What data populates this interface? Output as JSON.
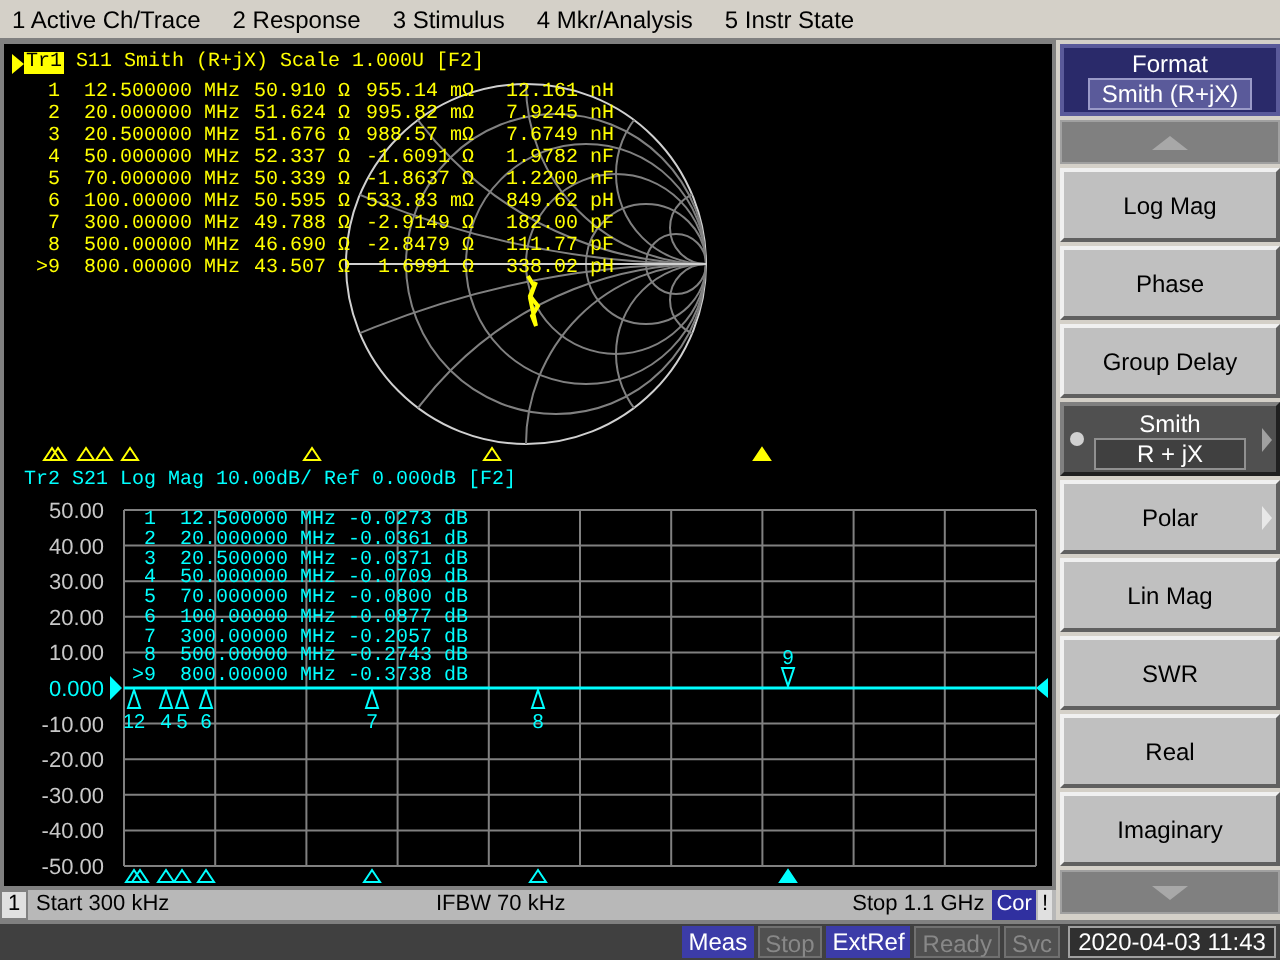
{
  "menu_bar": [
    "1 Active Ch/Trace",
    "2 Response",
    "3 Stimulus",
    "4 Mkr/Analysis",
    "5 Instr State"
  ],
  "trace1": {
    "label": "Tr1",
    "active": true,
    "header": "S11 Smith (R+jX) Scale 1.000U [F2]",
    "markers": [
      {
        "label": "1",
        "freq": "12.500000 MHz",
        "r": "50.910 Ω",
        "x": "955.14 mΩ",
        "lc": "12.161 nH",
        "active": false
      },
      {
        "label": "2",
        "freq": "20.000000 MHz",
        "r": "51.624 Ω",
        "x": "995.82 mΩ",
        "lc": "7.9245 nH",
        "active": false
      },
      {
        "label": "3",
        "freq": "20.500000 MHz",
        "r": "51.676 Ω",
        "x": "988.57 mΩ",
        "lc": "7.6749 nH",
        "active": false
      },
      {
        "label": "4",
        "freq": "50.000000 MHz",
        "r": "52.337 Ω",
        "x": "-1.6091 Ω",
        "lc": "1.9782 nF",
        "active": false
      },
      {
        "label": "5",
        "freq": "70.000000 MHz",
        "r": "50.339 Ω",
        "x": "-1.8637 Ω",
        "lc": "1.2200 nF",
        "active": false
      },
      {
        "label": "6",
        "freq": "100.00000 MHz",
        "r": "50.595 Ω",
        "x": "533.83 mΩ",
        "lc": "849.62 pH",
        "active": false
      },
      {
        "label": "7",
        "freq": "300.00000 MHz",
        "r": "49.788 Ω",
        "x": "-2.9149 Ω",
        "lc": "182.00 pF",
        "active": false
      },
      {
        "label": "8",
        "freq": "500.00000 MHz",
        "r": "46.690 Ω",
        "x": "-2.8479 Ω",
        "lc": "111.77 pF",
        "active": false
      },
      {
        "label": ">9",
        "freq": "800.00000 MHz",
        "r": "43.507 Ω",
        "x": "1.6991 Ω",
        "lc": "338.02 pH",
        "active": true
      }
    ]
  },
  "trace2": {
    "label": "Tr2",
    "active": false,
    "header": "S21 Log Mag 10.00dB/ Ref 0.000dB [F2]",
    "markers": [
      {
        "label": "1",
        "freq": "12.500000 MHz",
        "value": "-0.0273 dB",
        "flag": "12",
        "active": false
      },
      {
        "label": "2",
        "freq": "20.000000 MHz",
        "value": "-0.0361 dB",
        "active": false
      },
      {
        "label": "3",
        "freq": "20.500000 MHz",
        "value": "-0.0371 dB",
        "active": false
      },
      {
        "label": "4",
        "freq": "50.000000 MHz",
        "value": "-0.0709 dB",
        "flag": "4",
        "active": false
      },
      {
        "label": "5",
        "freq": "70.000000 MHz",
        "value": "-0.0800 dB",
        "flag": "5",
        "active": false
      },
      {
        "label": "6",
        "freq": "100.00000 MHz",
        "value": "-0.0877 dB",
        "flag": "6",
        "active": false
      },
      {
        "label": "7",
        "freq": "300.00000 MHz",
        "value": "-0.2057 dB",
        "flag": "7",
        "active": false
      },
      {
        "label": "8",
        "freq": "500.00000 MHz",
        "value": "-0.2743 dB",
        "flag": "8",
        "active": false
      },
      {
        "label": ">9",
        "freq": "800.00000 MHz",
        "value": "-0.3738 dB",
        "flag": "9",
        "active": true
      }
    ],
    "chart_data": {
      "type": "line",
      "grid": true,
      "categories": [
        null,
        null,
        null,
        null,
        null,
        null,
        null,
        null,
        null
      ],
      "ylim": [
        -50,
        50
      ],
      "yticks": [
        {
          "value": 50,
          "label": "50.00"
        },
        {
          "value": 40,
          "label": "40.00"
        },
        {
          "value": 30,
          "label": "30.00"
        },
        {
          "value": 20,
          "label": "20.00"
        },
        {
          "value": 10,
          "label": "10.00"
        },
        {
          "value": 0,
          "label": "0.000"
        },
        {
          "value": -10,
          "label": "-10.00"
        },
        {
          "value": -20,
          "label": "-20.00"
        },
        {
          "value": -30,
          "label": "-30.00"
        },
        {
          "value": -40,
          "label": "-40.00"
        },
        {
          "value": -50,
          "label": "-50.00"
        }
      ],
      "series": [
        {
          "color": "#00ffff",
          "values": [
            0,
            0,
            0,
            0,
            0,
            0,
            0,
            0,
            0
          ]
        }
      ]
    }
  },
  "channel_bar": {
    "channel": "1",
    "start": "Start 300 kHz",
    "ifbw": "IFBW 70 kHz",
    "stop": "Stop 1.1 GHz",
    "correction": "Cor",
    "warning": "!"
  },
  "softkeys": {
    "title": "Format",
    "value": "Smith (R+jX)",
    "items": [
      {
        "label": "Log Mag",
        "selected": false,
        "submenu": false
      },
      {
        "label": "Phase",
        "selected": false,
        "submenu": false
      },
      {
        "label": "Group Delay",
        "selected": false,
        "submenu": false
      },
      {
        "label": "Smith",
        "sublabel": "R + jX",
        "selected": true,
        "submenu": true
      },
      {
        "label": "Polar",
        "selected": false,
        "submenu": true
      },
      {
        "label": "Lin Mag",
        "selected": false,
        "submenu": false
      },
      {
        "label": "SWR",
        "selected": false,
        "submenu": false
      },
      {
        "label": "Real",
        "selected": false,
        "submenu": false
      },
      {
        "label": "Imaginary",
        "selected": false,
        "submenu": false
      }
    ]
  },
  "status_bar": {
    "indicators": [
      {
        "label": "Meas",
        "active": true
      },
      {
        "label": "Stop",
        "active": false
      },
      {
        "label": "ExtRef",
        "active": true
      },
      {
        "label": "Ready",
        "active": false
      },
      {
        "label": "Svc",
        "active": false
      }
    ],
    "datetime": "2020-04-03 11:43"
  }
}
